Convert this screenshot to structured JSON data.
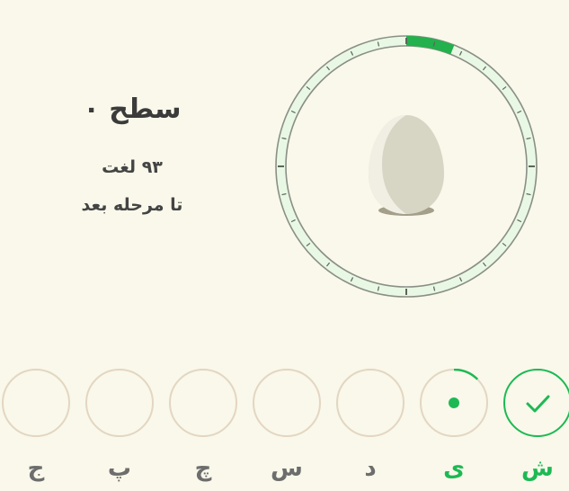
{
  "level": {
    "title": "سطح ۰",
    "word_count": "۹۳ لغت",
    "next_stage": "تا مرحله بعد"
  },
  "progress": {
    "fraction": 0.06,
    "color": "#22b14c",
    "track_color": "#e8f8e4"
  },
  "egg": {
    "icon": "egg-icon"
  },
  "days": [
    {
      "label": "ش",
      "state": "done"
    },
    {
      "label": "ی",
      "state": "current"
    },
    {
      "label": "د",
      "state": "empty"
    },
    {
      "label": "س",
      "state": "empty"
    },
    {
      "label": "چ",
      "state": "empty"
    },
    {
      "label": "پ",
      "state": "empty"
    },
    {
      "label": "ج",
      "state": "empty"
    }
  ],
  "colors": {
    "accent": "#1db954",
    "circle_border": "#e3d6c2",
    "background": "#f9f8ea"
  }
}
